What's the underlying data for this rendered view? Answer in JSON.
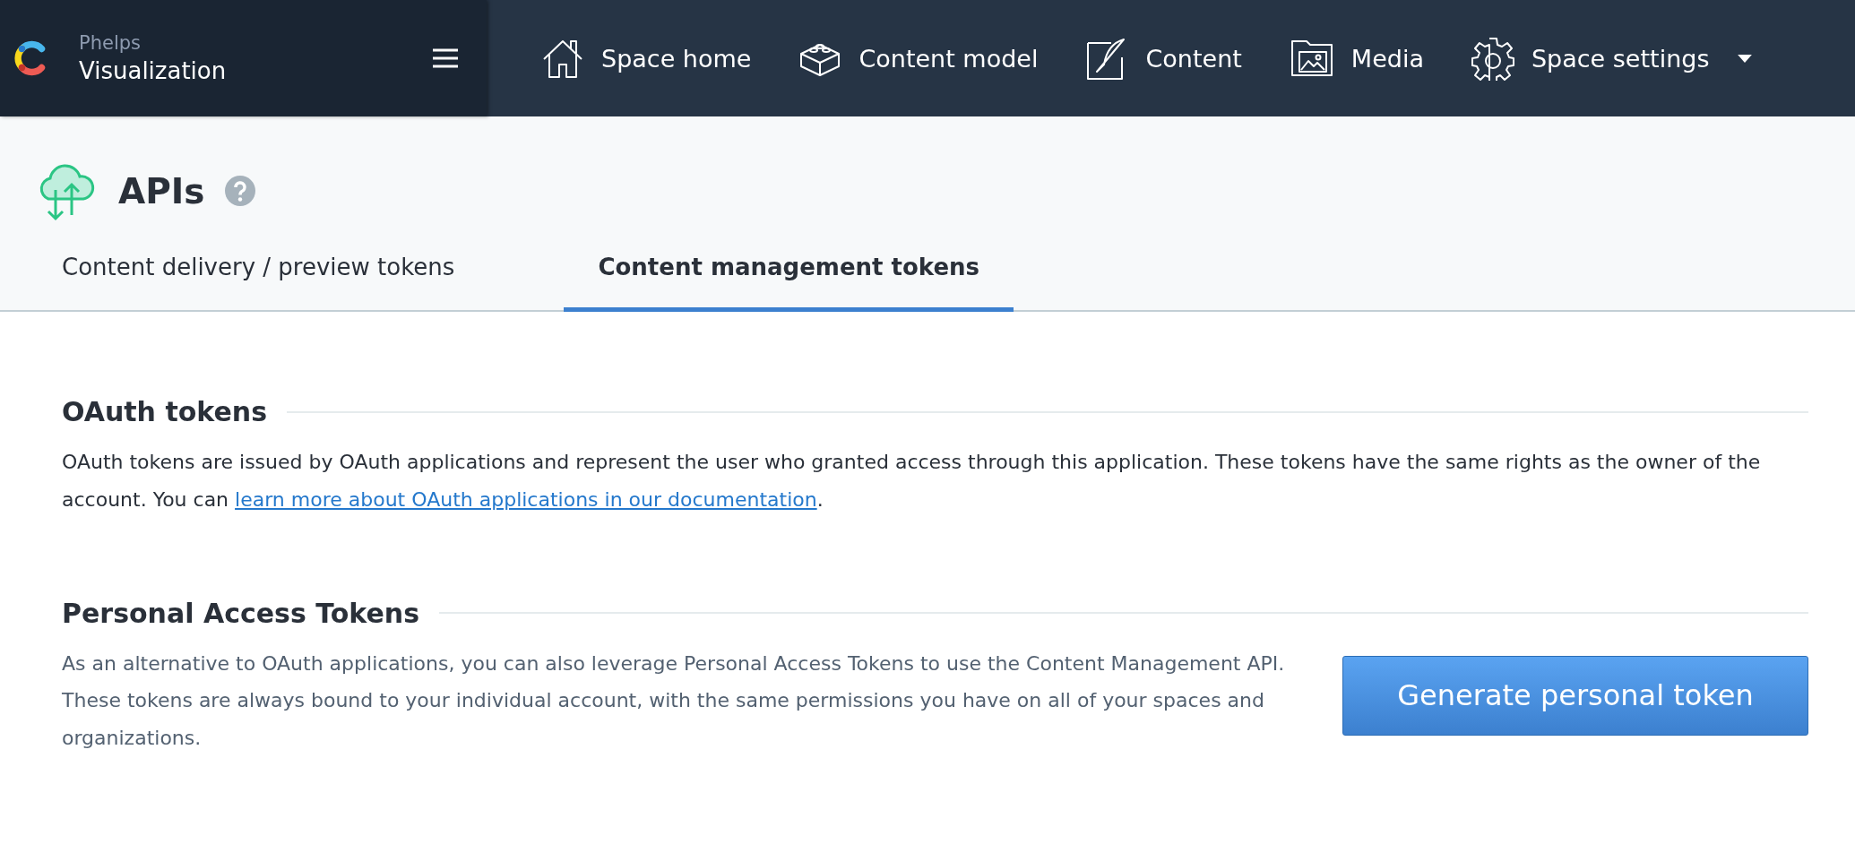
{
  "sidebar_header": {
    "space_org": "Phelps",
    "space_name": "Visualization"
  },
  "nav": [
    {
      "kind": "home",
      "label": "Space home",
      "dropdown": false
    },
    {
      "kind": "model",
      "label": "Content model",
      "dropdown": false
    },
    {
      "kind": "content",
      "label": "Content",
      "dropdown": false
    },
    {
      "kind": "media",
      "label": "Media",
      "dropdown": false
    },
    {
      "kind": "settings",
      "label": "Space settings",
      "dropdown": true
    }
  ],
  "page": {
    "title": "APIs"
  },
  "tabs": [
    {
      "label": "Content delivery / preview tokens",
      "selected": false
    },
    {
      "label": "Content management tokens",
      "selected": true
    }
  ],
  "sections": [
    {
      "heading": "OAuth tokens",
      "text": "OAuth tokens are issued by OAuth applications and represent the user who granted access through this application. These tokens have the same rights as the owner of the account. You can ",
      "link": "learn more about OAuth applications in our documentation",
      "text_after": "."
    },
    {
      "heading": "Personal Access Tokens",
      "text": "As an alternative to OAuth applications, you can also leverage Personal Access Tokens to use the Content Management API. These tokens are always bound to your individual account, with the same permissions you have on all of your spaces and organizations.",
      "button": "Generate personal token"
    }
  ]
}
